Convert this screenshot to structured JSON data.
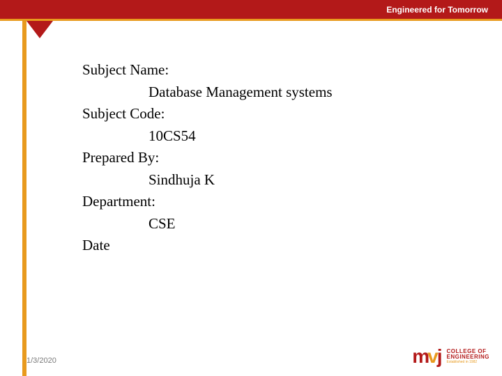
{
  "header": {
    "tagline": "Engineered for Tomorrow"
  },
  "content": {
    "subject_name_label": "Subject Name:",
    "subject_name_value": "Database Management systems",
    "subject_code_label": "Subject Code:",
    "subject_code_value": "10CS54",
    "prepared_by_label": "Prepared By:",
    "prepared_by_value": "Sindhuja K",
    "department_label": "Department:",
    "department_value": "CSE",
    "date_label": "Date"
  },
  "footer": {
    "date": "1/3/2020"
  },
  "logo": {
    "m": "m",
    "v": "v",
    "j": "j",
    "line1": "COLLEGE OF",
    "line2": "ENGINEERING",
    "sub": "Established in 1982"
  }
}
